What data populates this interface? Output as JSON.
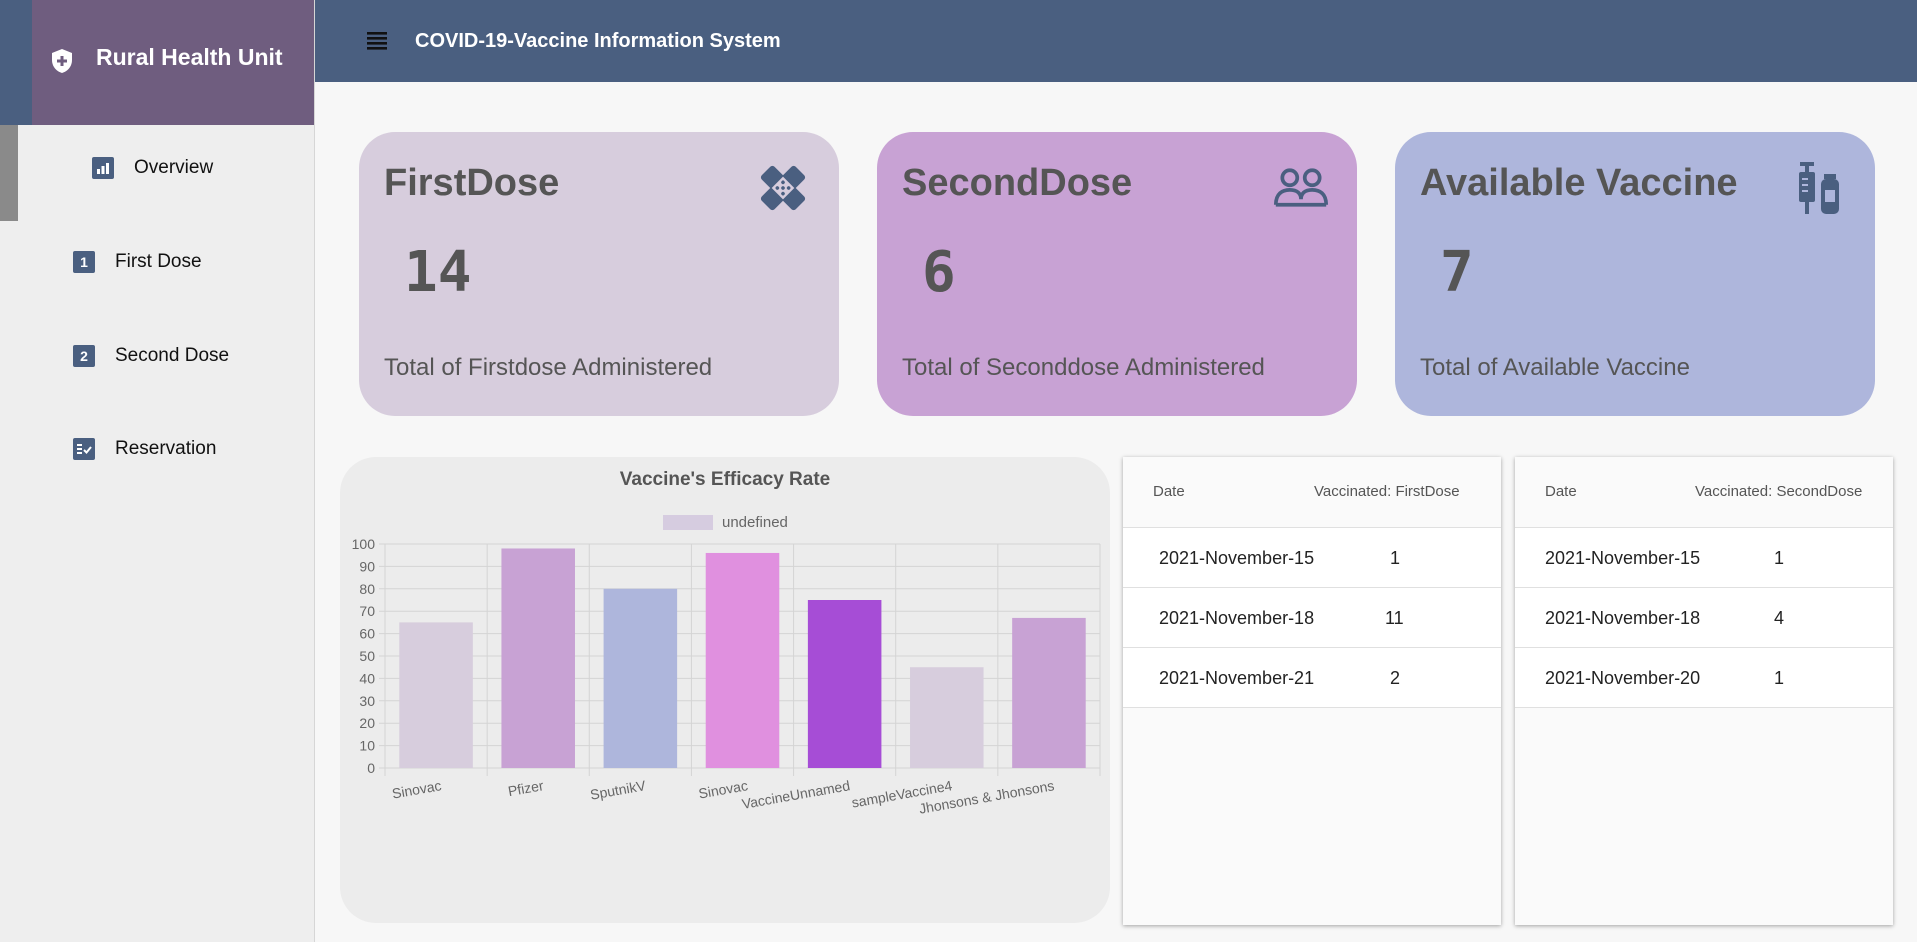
{
  "sidebar": {
    "brand_title": "Rural Health Unit",
    "brand_icon": "shield-plus-icon",
    "items": [
      {
        "label": "Overview",
        "icon": "chart-icon",
        "active": true
      },
      {
        "label": "First Dose",
        "icon": "number-one-icon",
        "glyph": "1"
      },
      {
        "label": "Second Dose",
        "icon": "number-two-icon",
        "glyph": "2"
      },
      {
        "label": "Reservation",
        "icon": "checklist-icon"
      }
    ]
  },
  "header": {
    "title": "COVID-19-Vaccine Information System",
    "menu_icon": "hamburger-menu-icon"
  },
  "cards": [
    {
      "title": "FirstDose",
      "value": "14",
      "desc": "Total of Firstdose Administered",
      "icon": "bandage-icon",
      "color": "#d7cddd"
    },
    {
      "title": "SecondDose",
      "value": "6",
      "desc": "Total of Seconddose Administered",
      "icon": "people-icon",
      "color": "#c8a2d4"
    },
    {
      "title": "Available Vaccine",
      "value": "7",
      "desc": "Total of Available Vaccine",
      "icon": "vaccine-vial-icon",
      "color": "#aeb6dc"
    }
  ],
  "chart_data": {
    "type": "bar",
    "title": "Vaccine's Efficacy Rate",
    "legend": "undefined",
    "legend_position": "top",
    "categories": [
      "Sinovac",
      "Pfizer",
      "SputnikV",
      "Sinovac",
      "VaccineUnnamed",
      "sampleVaccine4",
      "Jhonsons & Jhonsons"
    ],
    "values": [
      65,
      98,
      80,
      96,
      75,
      45,
      67
    ],
    "colors": [
      "#d7cddd",
      "#c8a2d4",
      "#aeb6dc",
      "#e090df",
      "#a64dd6",
      "#d7cddd",
      "#c8a2d4"
    ],
    "ylim": [
      0,
      100
    ],
    "yticks": [
      "0",
      "10",
      "20",
      "30",
      "40",
      "50",
      "60",
      "70",
      "80",
      "90",
      "100"
    ],
    "grid": true
  },
  "tables": [
    {
      "headers": [
        "Date",
        "Vaccinated: FirstDose"
      ],
      "rows": [
        [
          "2021-November-15",
          "1"
        ],
        [
          "2021-November-18",
          "11"
        ],
        [
          "2021-November-21",
          "2"
        ]
      ]
    },
    {
      "headers": [
        "Date",
        "Vaccinated: SecondDose"
      ],
      "rows": [
        [
          "2021-November-15",
          "1"
        ],
        [
          "2021-November-18",
          "4"
        ],
        [
          "2021-November-20",
          "1"
        ]
      ]
    }
  ]
}
